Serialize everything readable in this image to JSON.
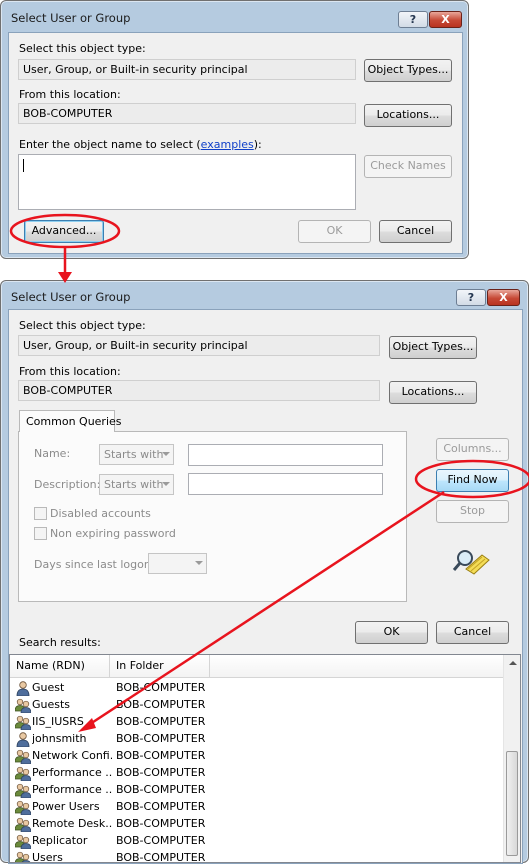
{
  "dialog1": {
    "title": "Select User or Group",
    "help_glyph": "?",
    "close_glyph": "X",
    "object_type_label": "Select this object type:",
    "object_type_value": "User, Group, or Built-in security principal",
    "object_types_button": "Object Types...",
    "location_label": "From this location:",
    "location_value": "BOB-COMPUTER",
    "locations_button": "Locations...",
    "enter_name_label": "Enter the object name to select (",
    "examples_link": "examples",
    "enter_name_suffix": "):",
    "name_input_value": "",
    "check_names_button": "Check Names",
    "advanced_button": "Advanced...",
    "ok_button": "OK",
    "cancel_button": "Cancel"
  },
  "dialog2": {
    "title": "Select User or Group",
    "help_glyph": "?",
    "close_glyph": "X",
    "object_type_label": "Select this object type:",
    "object_type_value": "User, Group, or Built-in security principal",
    "object_types_button": "Object Types...",
    "location_label": "From this location:",
    "location_value": "BOB-COMPUTER",
    "locations_button": "Locations...",
    "tab_label": "Common Queries",
    "name_label": "Name:",
    "name_mode": "Starts with",
    "description_label": "Description:",
    "description_mode": "Starts with",
    "disabled_accounts_label": "Disabled accounts",
    "disabled_accounts_checked": false,
    "non_expiring_label": "Non expiring password",
    "non_expiring_checked": false,
    "days_logon_label": "Days since last logon:",
    "days_logon_value": "",
    "columns_button": "Columns...",
    "find_now_button": "Find Now",
    "stop_button": "Stop",
    "ok_button": "OK",
    "cancel_button": "Cancel",
    "search_results_label": "Search results:",
    "columns": [
      "Name (RDN)",
      "In Folder"
    ],
    "rows": [
      {
        "name": "Guest",
        "folder": "BOB-COMPUTER",
        "icon": "user-icon"
      },
      {
        "name": "Guests",
        "folder": "BOB-COMPUTER",
        "icon": "group-icon"
      },
      {
        "name": "IIS_IUSRS",
        "folder": "BOB-COMPUTER",
        "icon": "group-icon"
      },
      {
        "name": "johnsmith",
        "folder": "BOB-COMPUTER",
        "icon": "user-icon"
      },
      {
        "name": "Network Confi...",
        "folder": "BOB-COMPUTER",
        "icon": "group-icon"
      },
      {
        "name": "Performance ...",
        "folder": "BOB-COMPUTER",
        "icon": "group-icon"
      },
      {
        "name": "Performance ...",
        "folder": "BOB-COMPUTER",
        "icon": "group-icon"
      },
      {
        "name": "Power Users",
        "folder": "BOB-COMPUTER",
        "icon": "group-icon"
      },
      {
        "name": "Remote Desk...",
        "folder": "BOB-COMPUTER",
        "icon": "group-icon"
      },
      {
        "name": "Replicator",
        "folder": "BOB-COMPUTER",
        "icon": "group-icon"
      },
      {
        "name": "Users",
        "folder": "BOB-COMPUTER",
        "icon": "group-icon"
      }
    ]
  },
  "annotations": {
    "highlight_color": "#e8141e"
  }
}
